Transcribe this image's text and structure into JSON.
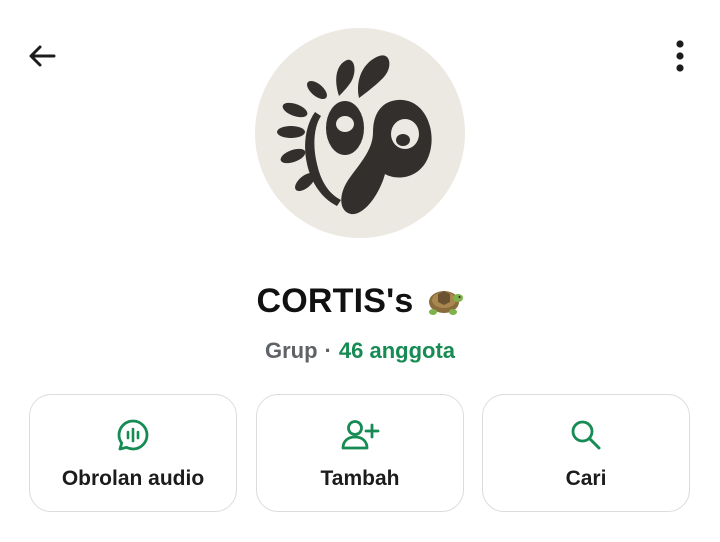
{
  "group": {
    "name": "CORTIS's",
    "emoji_icon": "turtle-icon",
    "type_label": "Grup",
    "separator": "·",
    "members_label": "46 anggota"
  },
  "header": {
    "back_icon": "arrow-left-icon",
    "menu_icon": "more-vertical-icon"
  },
  "actions": [
    {
      "label": "Obrolan audio",
      "icon": "audio-chat-icon"
    },
    {
      "label": "Tambah",
      "icon": "add-person-icon"
    },
    {
      "label": "Cari",
      "icon": "search-icon"
    }
  ],
  "colors": {
    "accent": "#168b53",
    "avatar_bg": "#ece8e2",
    "avatar_fg": "#332f2c"
  }
}
